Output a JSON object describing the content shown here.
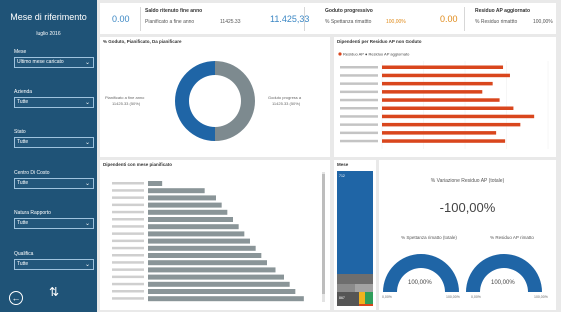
{
  "sidebar": {
    "title": "Mese di riferimento",
    "period": "luglio 2016",
    "filters": [
      {
        "label": "Mese",
        "value": "Ultimo mese caricato"
      },
      {
        "label": "Azienda",
        "value": "Tutte"
      },
      {
        "label": "Stato",
        "value": "Tutte"
      },
      {
        "label": "Centro Di Costo",
        "value": "Tutte"
      },
      {
        "label": "Natura Rapporto",
        "value": "Tutte"
      },
      {
        "label": "Qualifica",
        "value": "Tutte"
      }
    ]
  },
  "kpis": [
    {
      "value": "0.00"
    },
    {
      "title": "Saldo ritenuto fine anno",
      "sublabel": "Pianificato a fine anno",
      "subvalue": "11425.33",
      "value": "11.425,33"
    },
    {
      "title": "Goduto progressivo",
      "sublabel": "% Spettanza rimattto",
      "subvalue": "100,00%",
      "value": "0.00"
    },
    {
      "title": "Residuo AP aggiornato",
      "sublabel": "% Residuo rimattto",
      "subvalue": "100,00%"
    }
  ],
  "donut": {
    "title": "% Goduto, Pianificato, Da pianificare",
    "label_left_l1": "Pianificato a fine anno",
    "label_left_l2": "11425.33 (50%)",
    "label_right_l1": "Goduto progress a",
    "label_right_l2": "11425.33 (50%)",
    "colors": {
      "pianificato": "#7d8a8f",
      "goduto": "#1f65a6"
    }
  },
  "residuo": {
    "title": "Dipendenti per Residuo AP non Goduto",
    "legend_text": "Residuo AP  ● Residuo AP aggiornato",
    "color": "#d9461d"
  },
  "pianificato": {
    "title": "Dipendenti con mese pianificato",
    "color": "#8a9598"
  },
  "treemap": {
    "title": "Mese",
    "tiles": [
      "712",
      "867"
    ]
  },
  "variation": {
    "label": "% Variazione Residuo AP (totale)",
    "value": "-100,00%"
  },
  "gauges": [
    {
      "title": "% Spettanza rimatto (totale)",
      "value": "100,00%",
      "min": "0,00%",
      "max": "100,00%",
      "fraction": 1.0
    },
    {
      "title": "% Residuo AP rimatto",
      "value": "100,00%",
      "min": "0,00%",
      "max": "100,00%",
      "fraction": 1.0
    }
  ],
  "chart_data": [
    {
      "type": "pie",
      "title": "% Goduto, Pianificato, Da pianificare",
      "labels": [
        "Pianificato a fine anno",
        "Goduto progress a"
      ],
      "values": [
        50,
        50
      ]
    },
    {
      "type": "bar",
      "title": "Dipendenti per Residuo AP non Goduto",
      "series": [
        {
          "name": "Residuo AP",
          "values": [
            175,
            185,
            160,
            145,
            170,
            190,
            220,
            200,
            165,
            178
          ]
        }
      ],
      "xlim": [
        0,
        240
      ]
    },
    {
      "type": "bar",
      "title": "Dipendenti con mese pianificato",
      "series": [
        {
          "values": [
            5,
            20,
            24,
            26,
            28,
            30,
            32,
            34,
            36,
            38,
            40,
            42,
            45,
            48,
            50,
            52,
            55
          ]
        }
      ],
      "xlim": [
        0,
        60
      ]
    }
  ]
}
